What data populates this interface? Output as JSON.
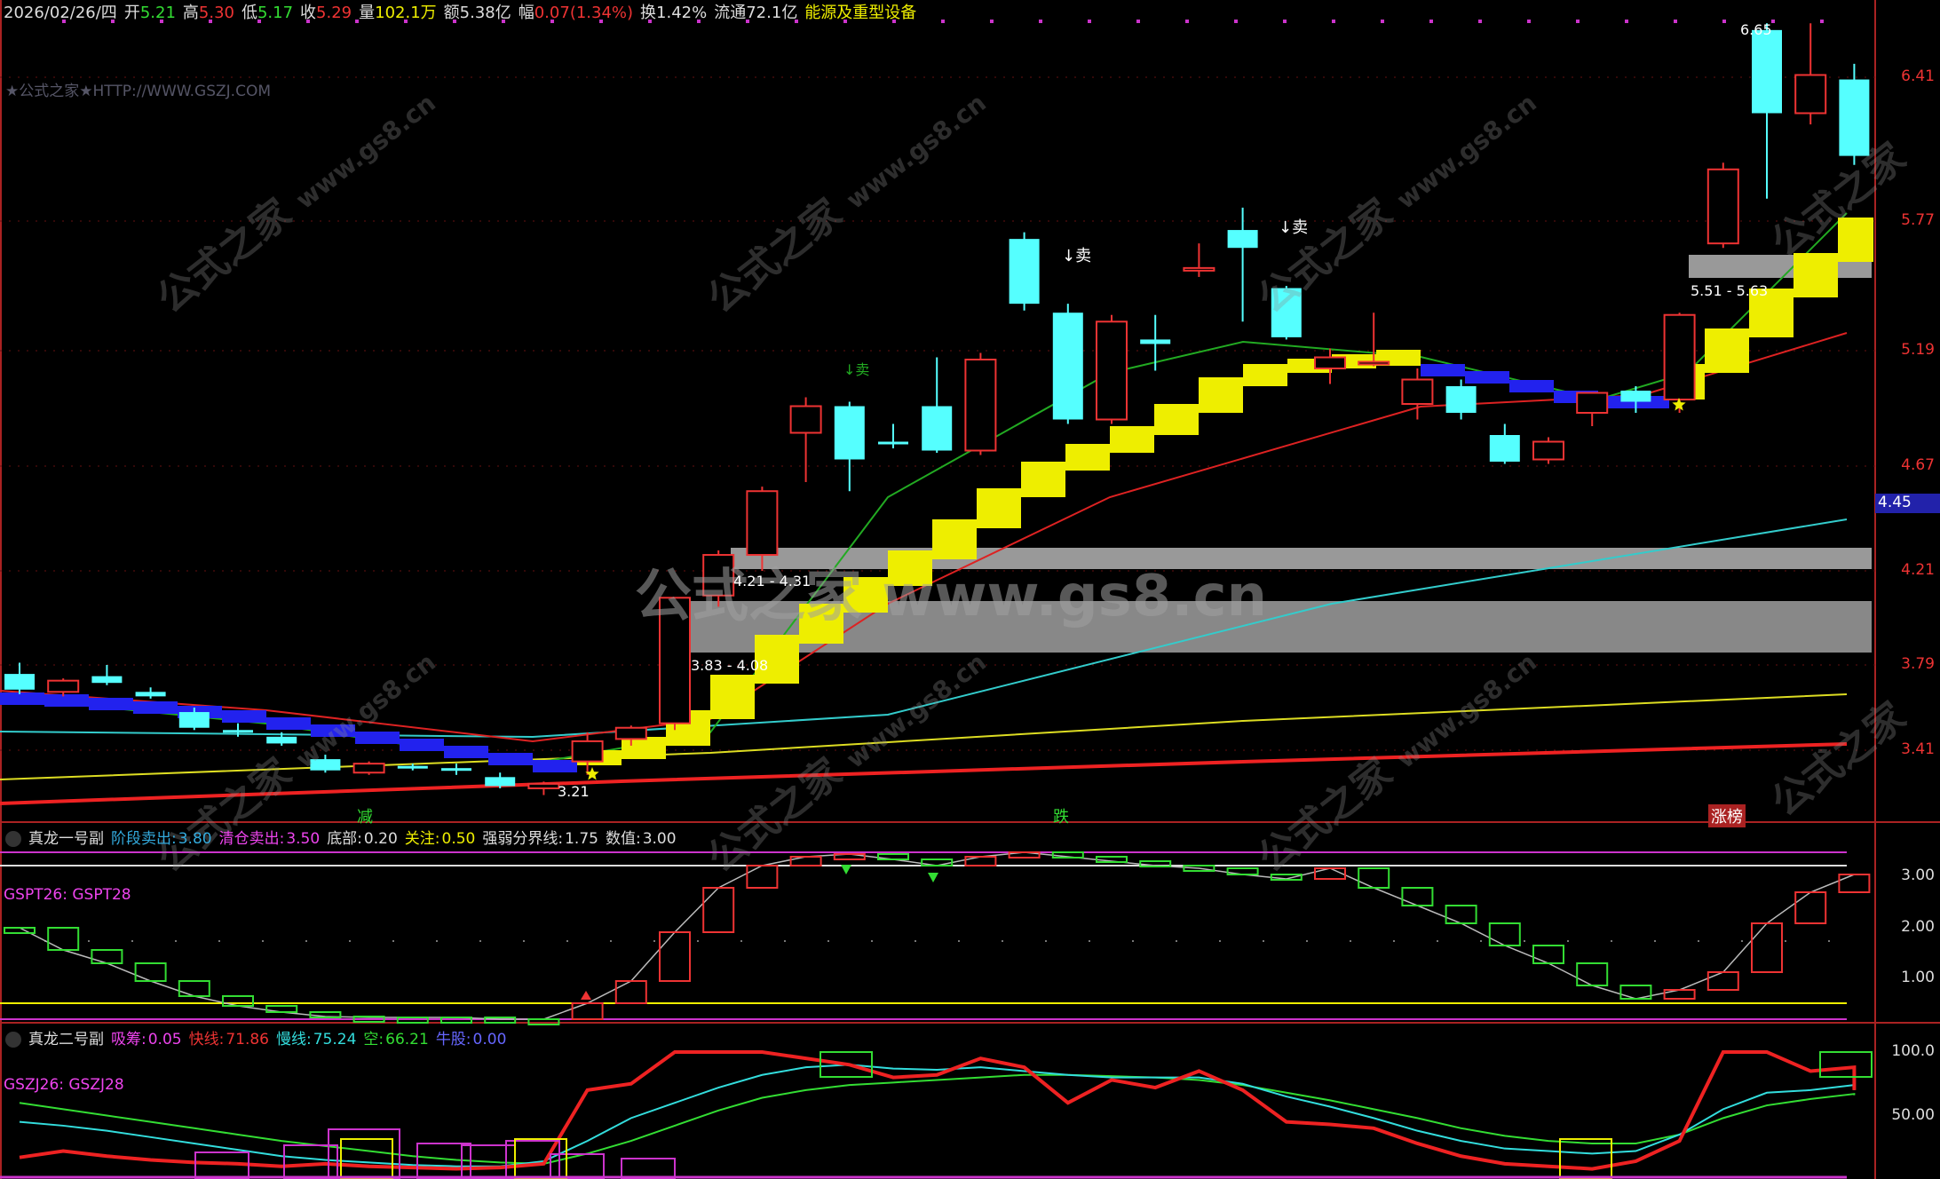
{
  "header": {
    "date": "2026/02/26/四",
    "open_label": "开",
    "open": "5.21",
    "high_label": "高",
    "high": "5.30",
    "low_label": "低",
    "low": "5.17",
    "close_label": "收",
    "close": "5.29",
    "vol_label": "量",
    "vol": "102.1万",
    "amt_label": "额",
    "amt": "5.38亿",
    "chg_label": "幅",
    "chg": "0.07(1.34%)",
    "turn_label": "换",
    "turn": "1.42%",
    "float_label": "流通",
    "float": "72.1亿",
    "sector": "能源及重型设备"
  },
  "site_text": "★公式之家★HTTP://WWW.GSZJ.COM",
  "watermark_text": "公式之家",
  "watermark_url": "www.gs8.cn",
  "watermark_big": "公式之家 www.gs8.cn",
  "main_panel": {
    "price_axis": [
      "6.41",
      "5.77",
      "5.19",
      "4.67",
      "4.21",
      "3.79",
      "3.41"
    ],
    "current_price_tag": "4.45",
    "zones": [
      {
        "label": "3.83 - 4.08"
      },
      {
        "label": "4.21 - 4.31"
      },
      {
        "label": "5.51 - 5.63"
      }
    ],
    "annotations": {
      "sell1": "↓卖",
      "sell2": "↓卖",
      "sell3": "↓卖",
      "high_mark": "6.65",
      "low_mark": "3.21"
    },
    "bottom_labels": [
      "减",
      "跌",
      "涨榜"
    ]
  },
  "sub1": {
    "name": "真龙一号副",
    "items": [
      {
        "label": "阶段卖出:",
        "value": "3.80",
        "color": "#3ad"
      },
      {
        "label": "清仓卖出:",
        "value": "3.50",
        "color": "#e4e"
      },
      {
        "label": "底部:",
        "value": "0.20",
        "color": "#ddd"
      },
      {
        "label": "关注:",
        "value": "0.50",
        "color": "#ee0"
      },
      {
        "label": "强弱分界线:",
        "value": "1.75",
        "color": "#ddd"
      },
      {
        "label": "数值:",
        "value": "3.00",
        "color": "#ddd"
      }
    ],
    "formula": "GSPT26: GSPT28",
    "axis": [
      "3.00",
      "2.00",
      "1.00"
    ]
  },
  "sub2": {
    "name": "真龙二号副",
    "items": [
      {
        "label": "吸筹:",
        "value": "0.05",
        "color": "#e4e"
      },
      {
        "label": "快线:",
        "value": "71.86",
        "color": "#e33"
      },
      {
        "label": "慢线:",
        "value": "75.24",
        "color": "#3dd"
      },
      {
        "label": "空:",
        "value": "66.21",
        "color": "#3d3"
      },
      {
        "label": "牛股:",
        "value": "0.00",
        "color": "#66f"
      }
    ],
    "formula": "GSZJ26: GSZJ28",
    "axis": [
      "100.0",
      "50.00"
    ]
  },
  "chart_data": {
    "type": "candlestick",
    "price_axis_ticks": [
      6.41,
      5.77,
      5.19,
      4.67,
      4.21,
      3.79,
      3.41
    ],
    "candles": [
      {
        "o": 3.75,
        "h": 3.8,
        "l": 3.66,
        "c": 3.68
      },
      {
        "o": 3.67,
        "h": 3.73,
        "l": 3.65,
        "c": 3.72
      },
      {
        "o": 3.74,
        "h": 3.79,
        "l": 3.7,
        "c": 3.71
      },
      {
        "o": 3.67,
        "h": 3.69,
        "l": 3.64,
        "c": 3.65
      },
      {
        "o": 3.58,
        "h": 3.6,
        "l": 3.5,
        "c": 3.51
      },
      {
        "o": 3.5,
        "h": 3.53,
        "l": 3.47,
        "c": 3.49
      },
      {
        "o": 3.47,
        "h": 3.49,
        "l": 3.43,
        "c": 3.44
      },
      {
        "o": 3.37,
        "h": 3.39,
        "l": 3.31,
        "c": 3.32
      },
      {
        "o": 3.31,
        "h": 3.36,
        "l": 3.3,
        "c": 3.35
      },
      {
        "o": 3.34,
        "h": 3.35,
        "l": 3.32,
        "c": 3.33
      },
      {
        "o": 3.33,
        "h": 3.35,
        "l": 3.3,
        "c": 3.32
      },
      {
        "o": 3.29,
        "h": 3.31,
        "l": 3.24,
        "c": 3.25
      },
      {
        "o": 3.24,
        "h": 3.27,
        "l": 3.21,
        "c": 3.26
      },
      {
        "o": 3.36,
        "h": 3.49,
        "l": 3.3,
        "c": 3.45
      },
      {
        "o": 3.46,
        "h": 3.52,
        "l": 3.43,
        "c": 3.51
      },
      {
        "o": 3.53,
        "h": 4.09,
        "l": 3.5,
        "c": 4.09
      },
      {
        "o": 4.1,
        "h": 4.3,
        "l": 4.05,
        "c": 4.28
      },
      {
        "o": 4.28,
        "h": 4.58,
        "l": 4.21,
        "c": 4.56
      },
      {
        "o": 4.82,
        "h": 4.98,
        "l": 4.6,
        "c": 4.94
      },
      {
        "o": 4.94,
        "h": 4.96,
        "l": 4.56,
        "c": 4.7
      },
      {
        "o": 4.78,
        "h": 4.86,
        "l": 4.75,
        "c": 4.77
      },
      {
        "o": 4.94,
        "h": 5.16,
        "l": 4.73,
        "c": 4.74
      },
      {
        "o": 4.74,
        "h": 5.18,
        "l": 4.72,
        "c": 5.15
      },
      {
        "o": 5.69,
        "h": 5.72,
        "l": 5.37,
        "c": 5.4
      },
      {
        "o": 5.36,
        "h": 5.4,
        "l": 4.86,
        "c": 4.88
      },
      {
        "o": 4.88,
        "h": 5.35,
        "l": 4.86,
        "c": 5.32
      },
      {
        "o": 5.24,
        "h": 5.35,
        "l": 5.1,
        "c": 5.22
      },
      {
        "o": 5.55,
        "h": 5.67,
        "l": 5.52,
        "c": 5.56
      },
      {
        "o": 5.73,
        "h": 5.83,
        "l": 5.32,
        "c": 5.65
      },
      {
        "o": 5.47,
        "h": 5.48,
        "l": 5.24,
        "c": 5.25
      },
      {
        "o": 5.11,
        "h": 5.2,
        "l": 5.04,
        "c": 5.16
      },
      {
        "o": 5.13,
        "h": 5.36,
        "l": 5.12,
        "c": 5.14
      },
      {
        "o": 4.95,
        "h": 5.11,
        "l": 4.88,
        "c": 5.06
      },
      {
        "o": 5.03,
        "h": 5.06,
        "l": 4.88,
        "c": 4.91
      },
      {
        "o": 4.81,
        "h": 4.86,
        "l": 4.68,
        "c": 4.69
      },
      {
        "o": 4.7,
        "h": 4.8,
        "l": 4.68,
        "c": 4.78
      },
      {
        "o": 4.91,
        "h": 5.0,
        "l": 4.85,
        "c": 5.0
      },
      {
        "o": 5.01,
        "h": 5.03,
        "l": 4.91,
        "c": 4.96
      },
      {
        "o": 4.97,
        "h": 5.36,
        "l": 4.91,
        "c": 5.35
      },
      {
        "o": 5.67,
        "h": 6.03,
        "l": 5.65,
        "c": 6.0
      },
      {
        "o": 6.62,
        "h": 6.65,
        "l": 5.87,
        "c": 6.25
      },
      {
        "o": 6.25,
        "h": 6.65,
        "l": 6.2,
        "c": 6.42
      },
      {
        "o": 6.4,
        "h": 6.47,
        "l": 6.02,
        "c": 6.06
      }
    ]
  }
}
